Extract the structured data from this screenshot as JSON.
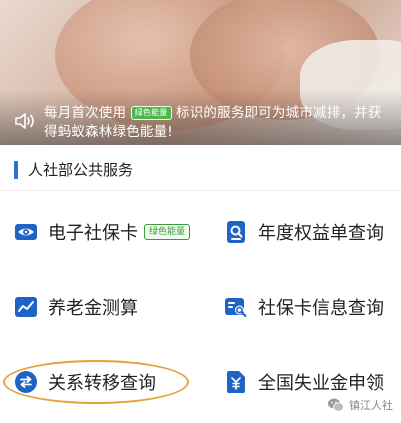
{
  "banner": {
    "notice_prefix": "每月首次使用",
    "eco_badge": "绿色能量",
    "notice_suffix": "标识的服务即可为城市减排，并获得蚂蚁森林绿色能量!"
  },
  "section": {
    "title": "人社部公共服务"
  },
  "services": {
    "e_card": {
      "label": "电子社保卡",
      "tag": "绿色能量"
    },
    "annual_rights": {
      "label": "年度权益单查询"
    },
    "pension_calc": {
      "label": "养老金测算"
    },
    "card_info": {
      "label": "社保卡信息查询"
    },
    "transfer_query": {
      "label": "关系转移查询"
    },
    "unemployment": {
      "label": "全国失业金申领"
    }
  },
  "watermark": {
    "text": "镇江人社"
  },
  "colors": {
    "accent_blue": "#2f6fd6",
    "icon_blue": "#1e63c6",
    "eco_green": "#3c9c3c",
    "highlight_orange": "#e4a23c"
  }
}
